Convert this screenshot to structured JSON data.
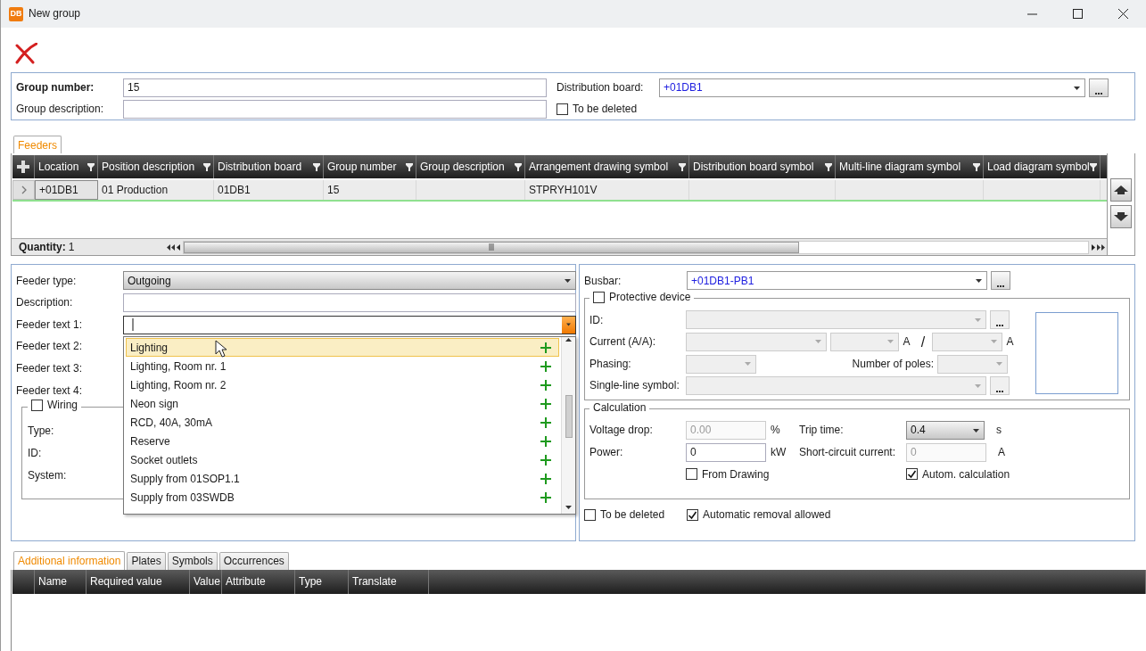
{
  "window": {
    "badge": "DB",
    "title": "New group"
  },
  "group": {
    "fields": [
      {
        "label": "Group number:",
        "value": "15",
        "bold": true
      },
      {
        "label": "Group description:",
        "bold": false
      }
    ],
    "distribution_board": {
      "label": "Distribution board:",
      "value": "+01DB1"
    },
    "to_be_deleted": {
      "label": "To be deleted",
      "checked": false
    }
  },
  "feeders": {
    "tabs": [
      {
        "label": "Feeders",
        "selected": true
      }
    ],
    "columns": [
      "Location",
      "Position description",
      "Distribution board",
      "Group number",
      "Group description",
      "Arrangement drawing symbol",
      "Distribution board symbol",
      "Multi-line diagram symbol",
      "Load diagram symbol"
    ],
    "rows": [
      {
        "cells": [
          "+01DB1",
          "01 Production",
          "01DB1",
          "15",
          null,
          "STPRYH101V",
          null,
          null,
          null
        ]
      }
    ],
    "quantity_label": "Quantity:",
    "quantity": "1"
  },
  "feeder": {
    "type": {
      "label": "Feeder type:",
      "value": "Outgoing"
    },
    "description": {
      "label": "Description:"
    },
    "texts": [
      "Feeder text 1:",
      "Feeder text 2:",
      "Feeder text 3:",
      "Feeder text 4:"
    ],
    "dropdown": [
      {
        "label": "Lighting",
        "selected": true
      },
      {
        "label": "Lighting, Room nr. 1",
        "selected": false
      },
      {
        "label": "Lighting, Room nr. 2",
        "selected": false
      },
      {
        "label": "Neon sign",
        "selected": false
      },
      {
        "label": "RCD, 40A, 30mA",
        "selected": false
      },
      {
        "label": "Reserve",
        "selected": false
      },
      {
        "label": "Socket outlets",
        "selected": false
      },
      {
        "label": "Supply from 01SOP1.1",
        "selected": false
      },
      {
        "label": "Supply from 03SWDB",
        "selected": false
      }
    ],
    "wiring": {
      "label": "Wiring",
      "checked": false,
      "fields": [
        "Type:",
        "ID:",
        "System:"
      ]
    }
  },
  "busbar": {
    "label": "Busbar:",
    "value": "+01DB1-PB1"
  },
  "protective_device": {
    "label": "Protective device",
    "checked": false,
    "id_label": "ID:",
    "current_label": "Current (A/A):",
    "unit_1": "A",
    "separator": "/",
    "unit_2": "A",
    "phasing_label": "Phasing:",
    "poles_label": "Number of poles:",
    "symbol_label": "Single-line symbol:"
  },
  "calculation": {
    "title": "Calculation",
    "voltage_drop": {
      "label": "Voltage drop:",
      "value": "0.00",
      "unit": "%",
      "disabled": true
    },
    "trip_time": {
      "label": "Trip time:",
      "value": "0.4",
      "unit": "s"
    },
    "power": {
      "label": "Power:",
      "value": "0",
      "unit": "kW",
      "disabled": false
    },
    "short_circuit": {
      "label": "Short-circuit current:",
      "value": "0",
      "unit": "A",
      "disabled": true
    },
    "from_drawing": {
      "label": "From Drawing",
      "checked": false
    },
    "autom": {
      "label": "Autom. calculation",
      "checked": true
    }
  },
  "flags": [
    {
      "label": "To be deleted",
      "checked": false
    },
    {
      "label": "Automatic removal allowed",
      "checked": true
    }
  ],
  "info": {
    "tabs": [
      {
        "label": "Additional information",
        "selected": true
      },
      {
        "label": "Plates",
        "selected": false
      },
      {
        "label": "Symbols",
        "selected": false
      },
      {
        "label": "Occurrences",
        "selected": false
      }
    ],
    "columns": [
      "Name",
      "Required value",
      "Value",
      "Attribute",
      "Type",
      "Translate"
    ]
  }
}
